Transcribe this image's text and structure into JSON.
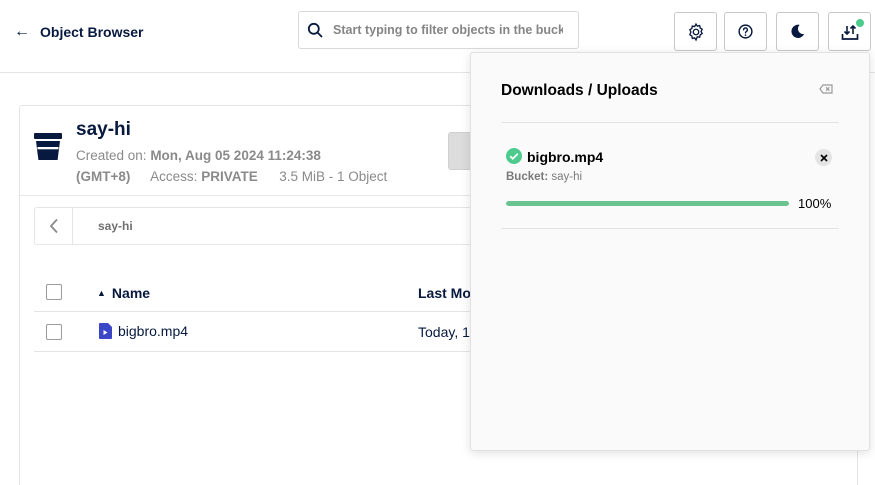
{
  "header": {
    "back_title": "Object Browser",
    "search_placeholder": "Start typing to filter objects in the bucket",
    "buttons": [
      {
        "name": "settings",
        "icon": "gear-icon"
      },
      {
        "name": "help",
        "icon": "question-icon"
      },
      {
        "name": "dark-mode",
        "icon": "moon-icon"
      },
      {
        "name": "downloads",
        "icon": "download-icon",
        "badge_color": "#4ccb8d"
      }
    ]
  },
  "bucket": {
    "name": "say-hi",
    "created_label": "Created on:",
    "created_value": "Mon, Aug 05 2024 11:24:38",
    "timezone": "(GMT+8)",
    "access_label": "Access:",
    "access_value": "PRIVATE",
    "summary": "3.5 MiB - 1 Object"
  },
  "breadcrumb": {
    "path": "say-hi"
  },
  "table": {
    "columns": [
      "Name",
      "Last Mo"
    ],
    "rows": [
      {
        "name": "bigbro.mp4",
        "last_modified": "Today, 1"
      }
    ]
  },
  "downloads": {
    "title": "Downloads / Uploads",
    "items": [
      {
        "file": "bigbro.mp4",
        "bucket_label": "Bucket:",
        "bucket": "say-hi",
        "progress_pct": 100,
        "progress_text": "100%"
      }
    ]
  },
  "colors": {
    "primary": "#07193e",
    "success": "#4ccb8d",
    "progress": "#6ac48f",
    "file_icon": "#3b47c6"
  }
}
